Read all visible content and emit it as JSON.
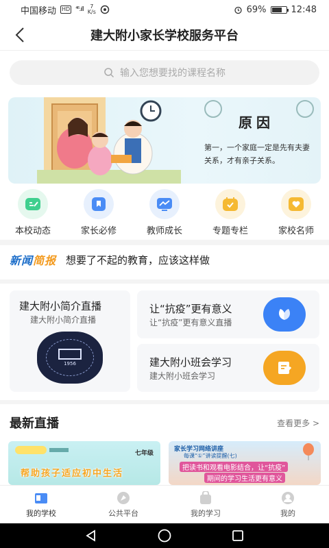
{
  "status_bar": {
    "carrier": "中国移动",
    "hd": "HD",
    "signal": "⁴⁶.ıll",
    "speed_value": "7",
    "speed_unit": "K/s",
    "battery_percent": "69%",
    "battery_level": 0.69,
    "time": "12:48"
  },
  "header": {
    "title": "建大附小家长学校服务平台"
  },
  "search": {
    "placeholder": "输入您想要找的课程名称"
  },
  "banner": {
    "title": "原因",
    "text": "第一，一个家庭一定是先有夫妻关系，才有亲子关系。"
  },
  "categories": [
    {
      "label": "本校动态",
      "icon": "edit-icon",
      "color": "#3fcf8e",
      "bg": "#e5f8ee"
    },
    {
      "label": "家长必修",
      "icon": "bookmark-icon",
      "color": "#4a8cf5",
      "bg": "#e7f0fd"
    },
    {
      "label": "教师成长",
      "icon": "chart-icon",
      "color": "#4a8cf5",
      "bg": "#e7f0fd"
    },
    {
      "label": "专题专栏",
      "icon": "calendar-icon",
      "color": "#f5b932",
      "bg": "#fdf3dc"
    },
    {
      "label": "家校名师",
      "icon": "heart-icon",
      "color": "#f5b932",
      "bg": "#fdf3dc"
    }
  ],
  "news": {
    "logo_a": "新闻",
    "logo_b": "简报",
    "text": "想要了不起的教育，应该这样做"
  },
  "cards": {
    "intro": {
      "title": "建大附小简介直播",
      "subtitle": "建大附小简介直播",
      "emblem_year": "1956"
    },
    "covid": {
      "title": "让“抗疫”更有意义",
      "subtitle": "让“抗疫”更有意义直播",
      "icon": "leaf-icon",
      "color": "#3b82f6"
    },
    "class": {
      "title": "建大附小班会学习",
      "subtitle": "建大附小班会学习",
      "icon": "note-icon",
      "color": "#f5a623"
    }
  },
  "live": {
    "title": "最新直播",
    "more": "查看更多 >",
    "items": [
      {
        "grade": "七年级",
        "caption": "帮助孩子适应初中生活"
      },
      {
        "title": "家长学习网络讲座",
        "sub": "每课“①”讲读提醒(七)",
        "line1": "把读书和观看电影结合，让“抗疫”",
        "line2": "期间的学习生活更有意义"
      }
    ]
  },
  "tabbar": [
    {
      "label": "我的学校",
      "icon": "school-icon",
      "active": true
    },
    {
      "label": "公共平台",
      "icon": "compass-icon",
      "active": false
    },
    {
      "label": "我的学习",
      "icon": "bag-icon",
      "active": false
    },
    {
      "label": "我的",
      "icon": "user-icon",
      "active": false
    }
  ]
}
